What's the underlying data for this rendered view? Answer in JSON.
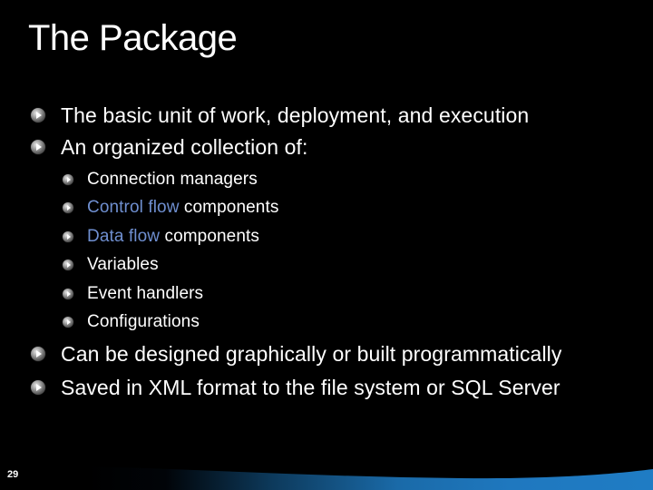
{
  "slide": {
    "title": "The Package",
    "page_number": "29",
    "accent_color": "#1f78bf",
    "link_color": "#6f8fd0",
    "bullets": [
      {
        "level": 1,
        "text": "The basic unit of work, deployment, and execution"
      },
      {
        "level": 1,
        "text": "An organized collection of:"
      },
      {
        "level": 2,
        "text": "Connection managers"
      },
      {
        "level": 2,
        "link": "Control flow",
        "text": " components"
      },
      {
        "level": 2,
        "link": "Data flow",
        "text": " components"
      },
      {
        "level": 2,
        "text": "Variables"
      },
      {
        "level": 2,
        "text": "Event handlers"
      },
      {
        "level": 2,
        "text": "Configurations"
      },
      {
        "level": 1,
        "text": "Can be designed graphically or built programmatically"
      },
      {
        "level": 1,
        "text": "Saved in XML format to the file system or SQL Server"
      }
    ],
    "bullet_icon": "orb-play-bullet-icon"
  }
}
